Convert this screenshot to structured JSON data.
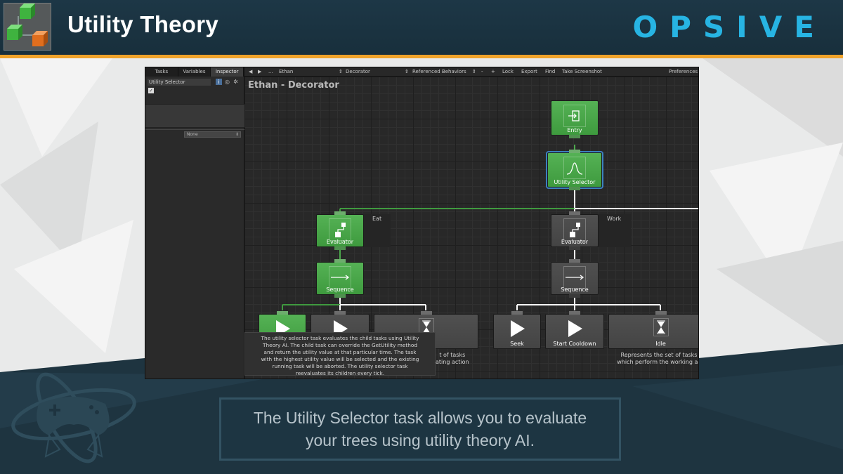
{
  "slide": {
    "title": "Utility Theory",
    "brand": "OPSIVE",
    "caption": "The Utility Selector task allows you to evaluate\nyour trees using utility theory AI."
  },
  "colors": {
    "header_bg": "#1d3746",
    "accent_line": "#f0a32a",
    "brand_blue": "#27b4e3",
    "node_green": "#4caa4c",
    "node_gray": "#4a4a4a",
    "selection_blue": "#3c7fbf"
  },
  "inspector": {
    "tabs": [
      {
        "label": "Tasks"
      },
      {
        "label": "Variables"
      },
      {
        "label": "Inspector"
      }
    ],
    "active_tab": "Inspector",
    "task_name": "Utility Selector",
    "instant_checked": true,
    "selector_value": "None"
  },
  "toolbar": {
    "back": "◀",
    "forward": "▶",
    "more": "...",
    "object": "Ethan",
    "behavior": "Decorator",
    "referenced": "Referenced Behaviors",
    "remove": "-",
    "add": "+",
    "lock": "Lock",
    "export": "Export",
    "find": "Find",
    "screenshot": "Take Screenshot",
    "preferences": "Preferences",
    "arrow": "⇕"
  },
  "graph": {
    "title": "Ethan - Decorator",
    "nodes": {
      "entry": {
        "label": "Entry",
        "icon": "entry-icon"
      },
      "utility_selector": {
        "label": "Utility Selector",
        "icon": "bell-curve-icon"
      },
      "evaluator_eat": {
        "label": "Evaluator",
        "side_label": "Eat",
        "icon": "evaluator-icon"
      },
      "evaluator_work": {
        "label": "Evaluator",
        "side_label": "Work",
        "icon": "evaluator-icon"
      },
      "sequence_eat": {
        "label": "Sequence",
        "icon": "arrow-right-icon"
      },
      "sequence_work": {
        "label": "Sequence",
        "icon": "arrow-right-icon"
      },
      "seek": {
        "label": "Seek",
        "icon": "play-icon"
      },
      "start_cooldown": {
        "label": "Start Cooldown",
        "icon": "play-icon"
      },
      "idle": {
        "label": "Idle",
        "icon": "hourglass-icon"
      }
    },
    "eat_desc_fragment": "t of tasks\nating action",
    "idle_desc": "Represents the set of tasks\nwhich perform the working ac",
    "tooltip": "The utility selector task evaluates the child tasks using Utility\nTheory AI. The child task can override the GetUtility method\nand return the utility value at that particular time. The task\nwith the highest utility value will be selected and the existing\nrunning task will be aborted. The utility selector task\nreevaluates its children every tick."
  }
}
